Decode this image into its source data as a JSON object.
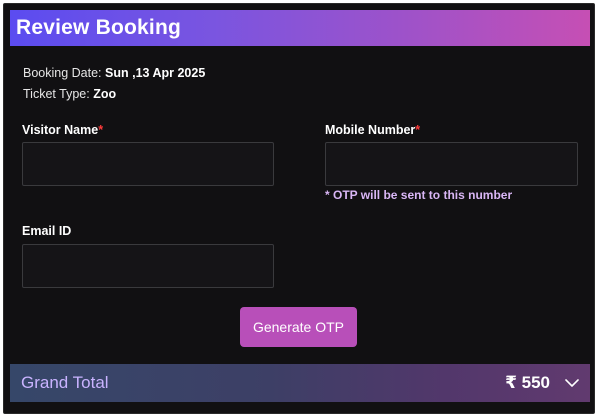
{
  "header": {
    "title": "Review Booking"
  },
  "booking": {
    "date_label": "Booking Date:",
    "date_value": "Sun ,13 Apr 2025",
    "ticket_label": "Ticket Type:",
    "ticket_value": "Zoo"
  },
  "form": {
    "visitor_name_label": "Visitor Name",
    "visitor_name_value": "",
    "mobile_label": "Mobile Number",
    "mobile_value": "",
    "required_mark": "*",
    "otp_note": "* OTP will be sent to this number",
    "email_label": "Email ID",
    "email_value": ""
  },
  "actions": {
    "generate_otp_label": "Generate OTP"
  },
  "total": {
    "label": "Grand Total",
    "amount": "₹ 550"
  },
  "colors": {
    "accent": "#b84fb9",
    "required": "#ff3b3b",
    "note": "#d9b6f5"
  },
  "icons": {
    "expand": "chevron-down-icon"
  }
}
